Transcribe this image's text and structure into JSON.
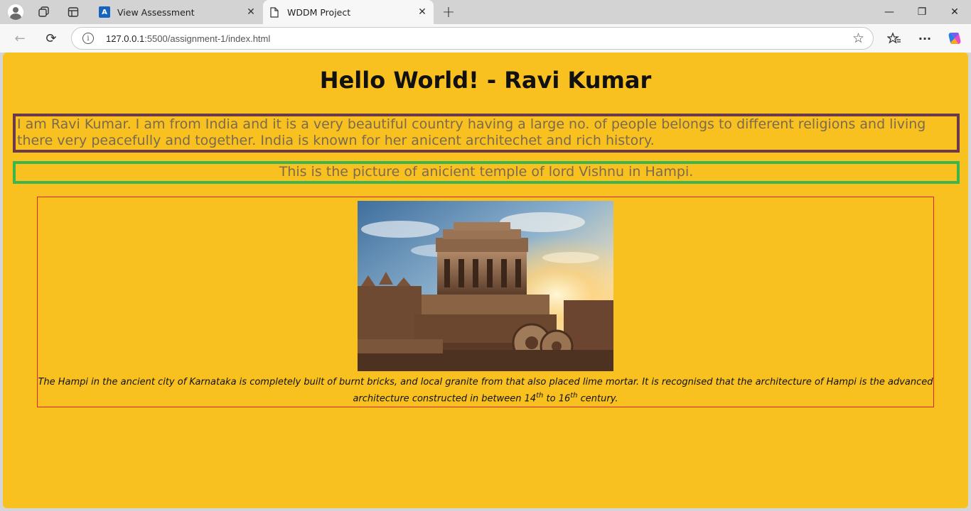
{
  "browser": {
    "tabs": [
      {
        "title": "View Assessment",
        "active": false,
        "icon": "assessment-app-icon"
      },
      {
        "title": "WDDM Project",
        "active": true,
        "icon": "page-icon"
      }
    ],
    "address": {
      "host": "127.0.0.1",
      "path": ":5500/assignment-1/index.html"
    },
    "close_glyph": "✕",
    "new_tab_glyph": "+",
    "window_controls": {
      "minimize": "—",
      "restore": "❐",
      "close": "✕"
    },
    "toolbar_glyphs": {
      "back": "←",
      "reload": "⟳",
      "star": "☆",
      "favorites": "☆≡",
      "more": "···"
    },
    "fav_letter": "A"
  },
  "page": {
    "title": "Hello World! - Ravi Kumar",
    "intro": "I am Ravi Kumar. I am from India and it is a very beautiful country having a large no. of people belongs to different religions and living there very peacefully and together. India is known for her anicent architechet and rich history.",
    "picture_caption": "This is the picture of anicient temple of lord Vishnu in Hampi.",
    "figure_caption": {
      "text_before": "The Hampi in the ancient city of Karnataka is completely built of burnt bricks, and local granite from that also placed lime mortar. It is recognised that the architecture of Hampi is the advanced architecture constructed in between 14",
      "sup1": "th",
      "middle": " to 16",
      "sup2": "th",
      "text_after": " century."
    }
  },
  "colors": {
    "page_background": "#f9c120",
    "intro_border": "#6b3a4a",
    "caption_border": "#3cb64c",
    "figure_border": "#d8232a"
  }
}
